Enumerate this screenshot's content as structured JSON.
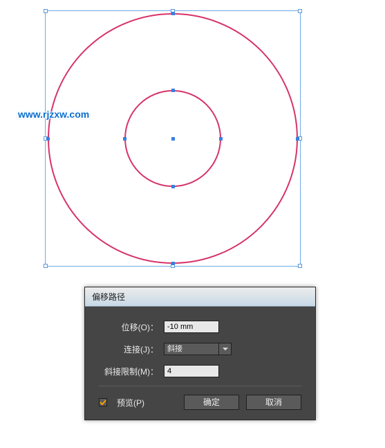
{
  "watermark": "www.rjzxw.com",
  "dialog": {
    "title": "偏移路径",
    "offset_label": "位移(O)：",
    "offset_value": "-10 mm",
    "join_label": "连接(J)：",
    "join_value": "斜接",
    "miter_label": "斜接限制(M)：",
    "miter_value": "4",
    "preview_label": "预览(P)",
    "preview_checked": true,
    "ok": "确定",
    "cancel": "取消"
  },
  "canvas": {
    "selection_color": "#6aa9e8",
    "stroke_color": "#d63369",
    "anchor_color": "#3a7fe0"
  }
}
